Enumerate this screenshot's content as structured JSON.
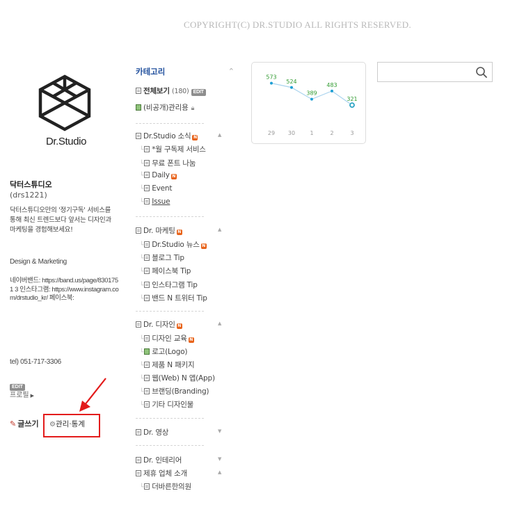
{
  "copyright": "COPYRIGHT(C) DR.STUDIO ALL RIGHTS RESERVED.",
  "profile": {
    "logo_text": "Dr.Studio",
    "blog_name": "닥터스튜디오",
    "blog_id": "(drs1221)",
    "description": "닥터스튜디오만의 '정기구독' 서비스를 통해 최신 트렌드보다 앞서는 디자인과 마케팅을 경험해보세요!",
    "tags": "Design & Marketing",
    "links_text": "네이버밴드: https://band.us/page/8301751 3 인스타그램: https://www.instagram.com/drstudio_kr/ 페이스북:",
    "tel": "tel) 051-717-3306",
    "edit_badge": "EDIT",
    "profile_link": "프로필",
    "write_label": "글쓰기",
    "admin_label": "관리·통계"
  },
  "categories": {
    "title": "카테고리",
    "all": {
      "label": "전체보기",
      "count": "(180)",
      "badge": "EDIT"
    },
    "private": {
      "label": "(비공개)관리용"
    },
    "groups": [
      {
        "label": "Dr.Studio 소식",
        "new": "N",
        "items": [
          {
            "label": "*월 구독제 서비스",
            "new": ""
          },
          {
            "label": "무료 폰트 나눔",
            "new": ""
          },
          {
            "label": "Daily",
            "new": "N"
          },
          {
            "label": "Event",
            "new": ""
          },
          {
            "label": "Issue",
            "new": ""
          }
        ]
      },
      {
        "label": "Dr. 마케팅",
        "new": "N",
        "items": [
          {
            "label": "Dr.Studio 뉴스",
            "new": "N"
          },
          {
            "label": "블로그 Tip",
            "new": ""
          },
          {
            "label": "페이스북 Tip",
            "new": ""
          },
          {
            "label": "인스타그램 Tip",
            "new": ""
          },
          {
            "label": "밴드 N 트위터 Tip",
            "new": ""
          }
        ]
      },
      {
        "label": "Dr. 디자인",
        "new": "N",
        "items": [
          {
            "label": "디자인 교육",
            "new": "N"
          },
          {
            "label": "로고(Logo)",
            "new": ""
          },
          {
            "label": "제품 N 패키지",
            "new": ""
          },
          {
            "label": "웹(Web) N 앱(App)",
            "new": ""
          },
          {
            "label": "브랜딩(Branding)",
            "new": ""
          },
          {
            "label": "기타 디자인물",
            "new": ""
          }
        ]
      },
      {
        "label": "Dr. 영상",
        "new": "",
        "items": []
      },
      {
        "label": "Dr. 인테리어",
        "new": "",
        "items": []
      },
      {
        "label": "제휴 업체 소개",
        "new": "",
        "items": [
          {
            "label": "더바른한의원",
            "new": ""
          }
        ]
      }
    ]
  },
  "chart_data": {
    "type": "line",
    "categories": [
      "29",
      "30",
      "1",
      "2",
      "3"
    ],
    "values": [
      573,
      524,
      389,
      483,
      321
    ],
    "ylim": [
      250,
      650
    ],
    "grid": false,
    "colors": {
      "line": "#a9d3ee",
      "point": "#1d9fd4",
      "label": "#2f9a2f",
      "last": "#2ba3c4"
    }
  },
  "search": {
    "value": "",
    "placeholder": ""
  }
}
